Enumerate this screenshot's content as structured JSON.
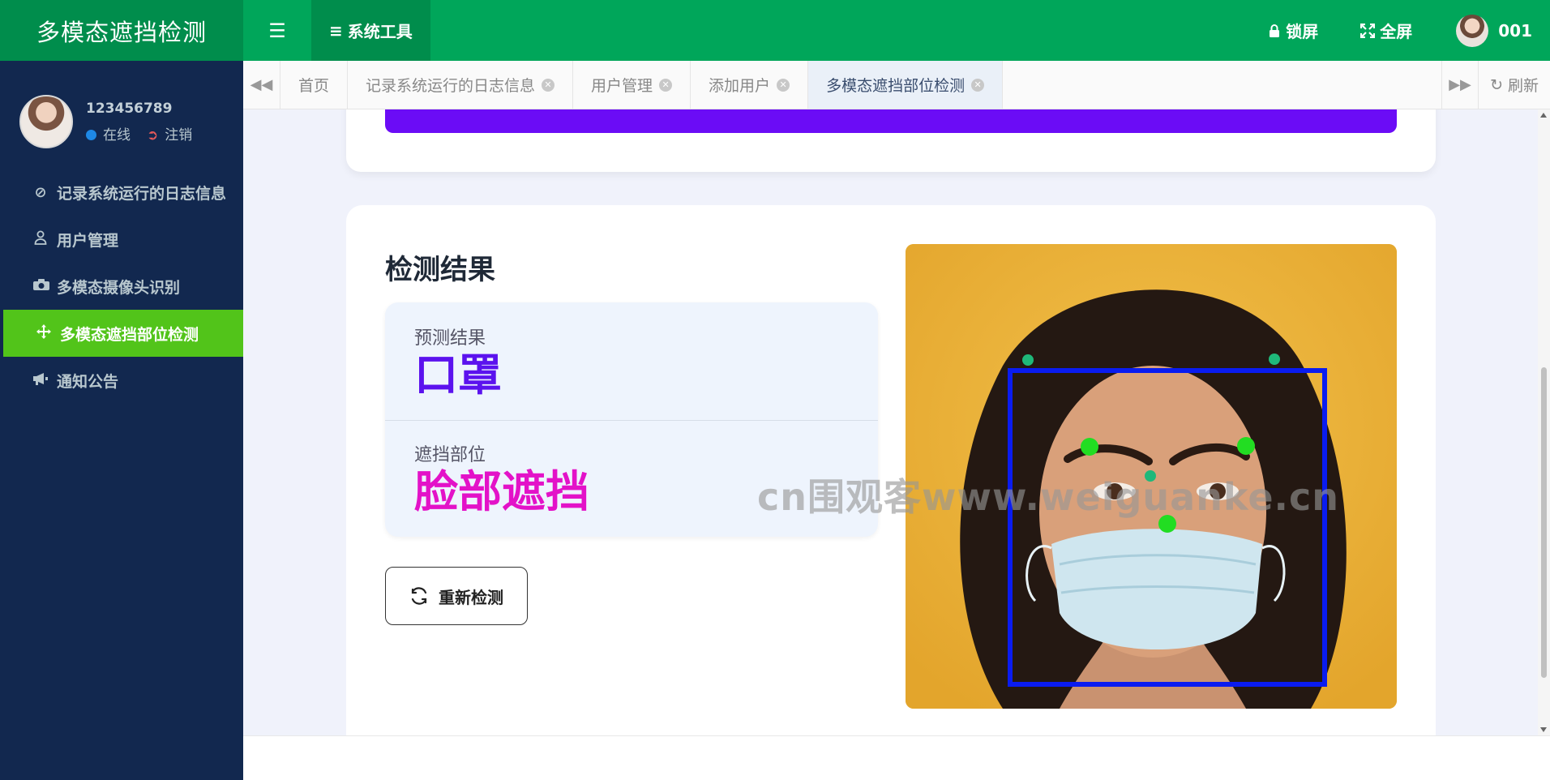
{
  "header": {
    "brand": "多模态遮挡检测",
    "system_tools": "系统工具",
    "lock_screen": "锁屏",
    "fullscreen": "全屏",
    "username": "001"
  },
  "sidebar": {
    "user_id": "123456789",
    "status_online": "在线",
    "logout": "注销",
    "items": [
      {
        "label": "记录系统运行的日志信息",
        "icon": "ban-icon"
      },
      {
        "label": "用户管理",
        "icon": "user-icon"
      },
      {
        "label": "多模态摄像头识别",
        "icon": "camera-icon"
      },
      {
        "label": "多模态遮挡部位检测",
        "icon": "move-icon",
        "active": true
      },
      {
        "label": "通知公告",
        "icon": "bullhorn-icon"
      }
    ]
  },
  "tabs": {
    "items": [
      {
        "label": "首页",
        "closable": false
      },
      {
        "label": "记录系统运行的日志信息",
        "closable": true
      },
      {
        "label": "用户管理",
        "closable": true
      },
      {
        "label": "添加用户",
        "closable": true
      },
      {
        "label": "多模态遮挡部位检测",
        "closable": true,
        "active": true
      }
    ],
    "refresh": "刷新"
  },
  "result": {
    "title": "检测结果",
    "pred_label": "预测结果",
    "pred_value": "口罩",
    "occl_label": "遮挡部位",
    "occl_value": "脸部遮挡",
    "redetect": "重新检测",
    "watermark": "cn围观客www.weiguanke.cn"
  },
  "colors": {
    "header": "#00a65a",
    "sidebar": "#12284f",
    "active_menu": "#52c41a",
    "primary_btn": "#6b0cf6",
    "pred_value": "#5b12ee",
    "occl_value": "#e312c8",
    "bbox": "#0a1cf0",
    "landmark": "#22dd22"
  }
}
